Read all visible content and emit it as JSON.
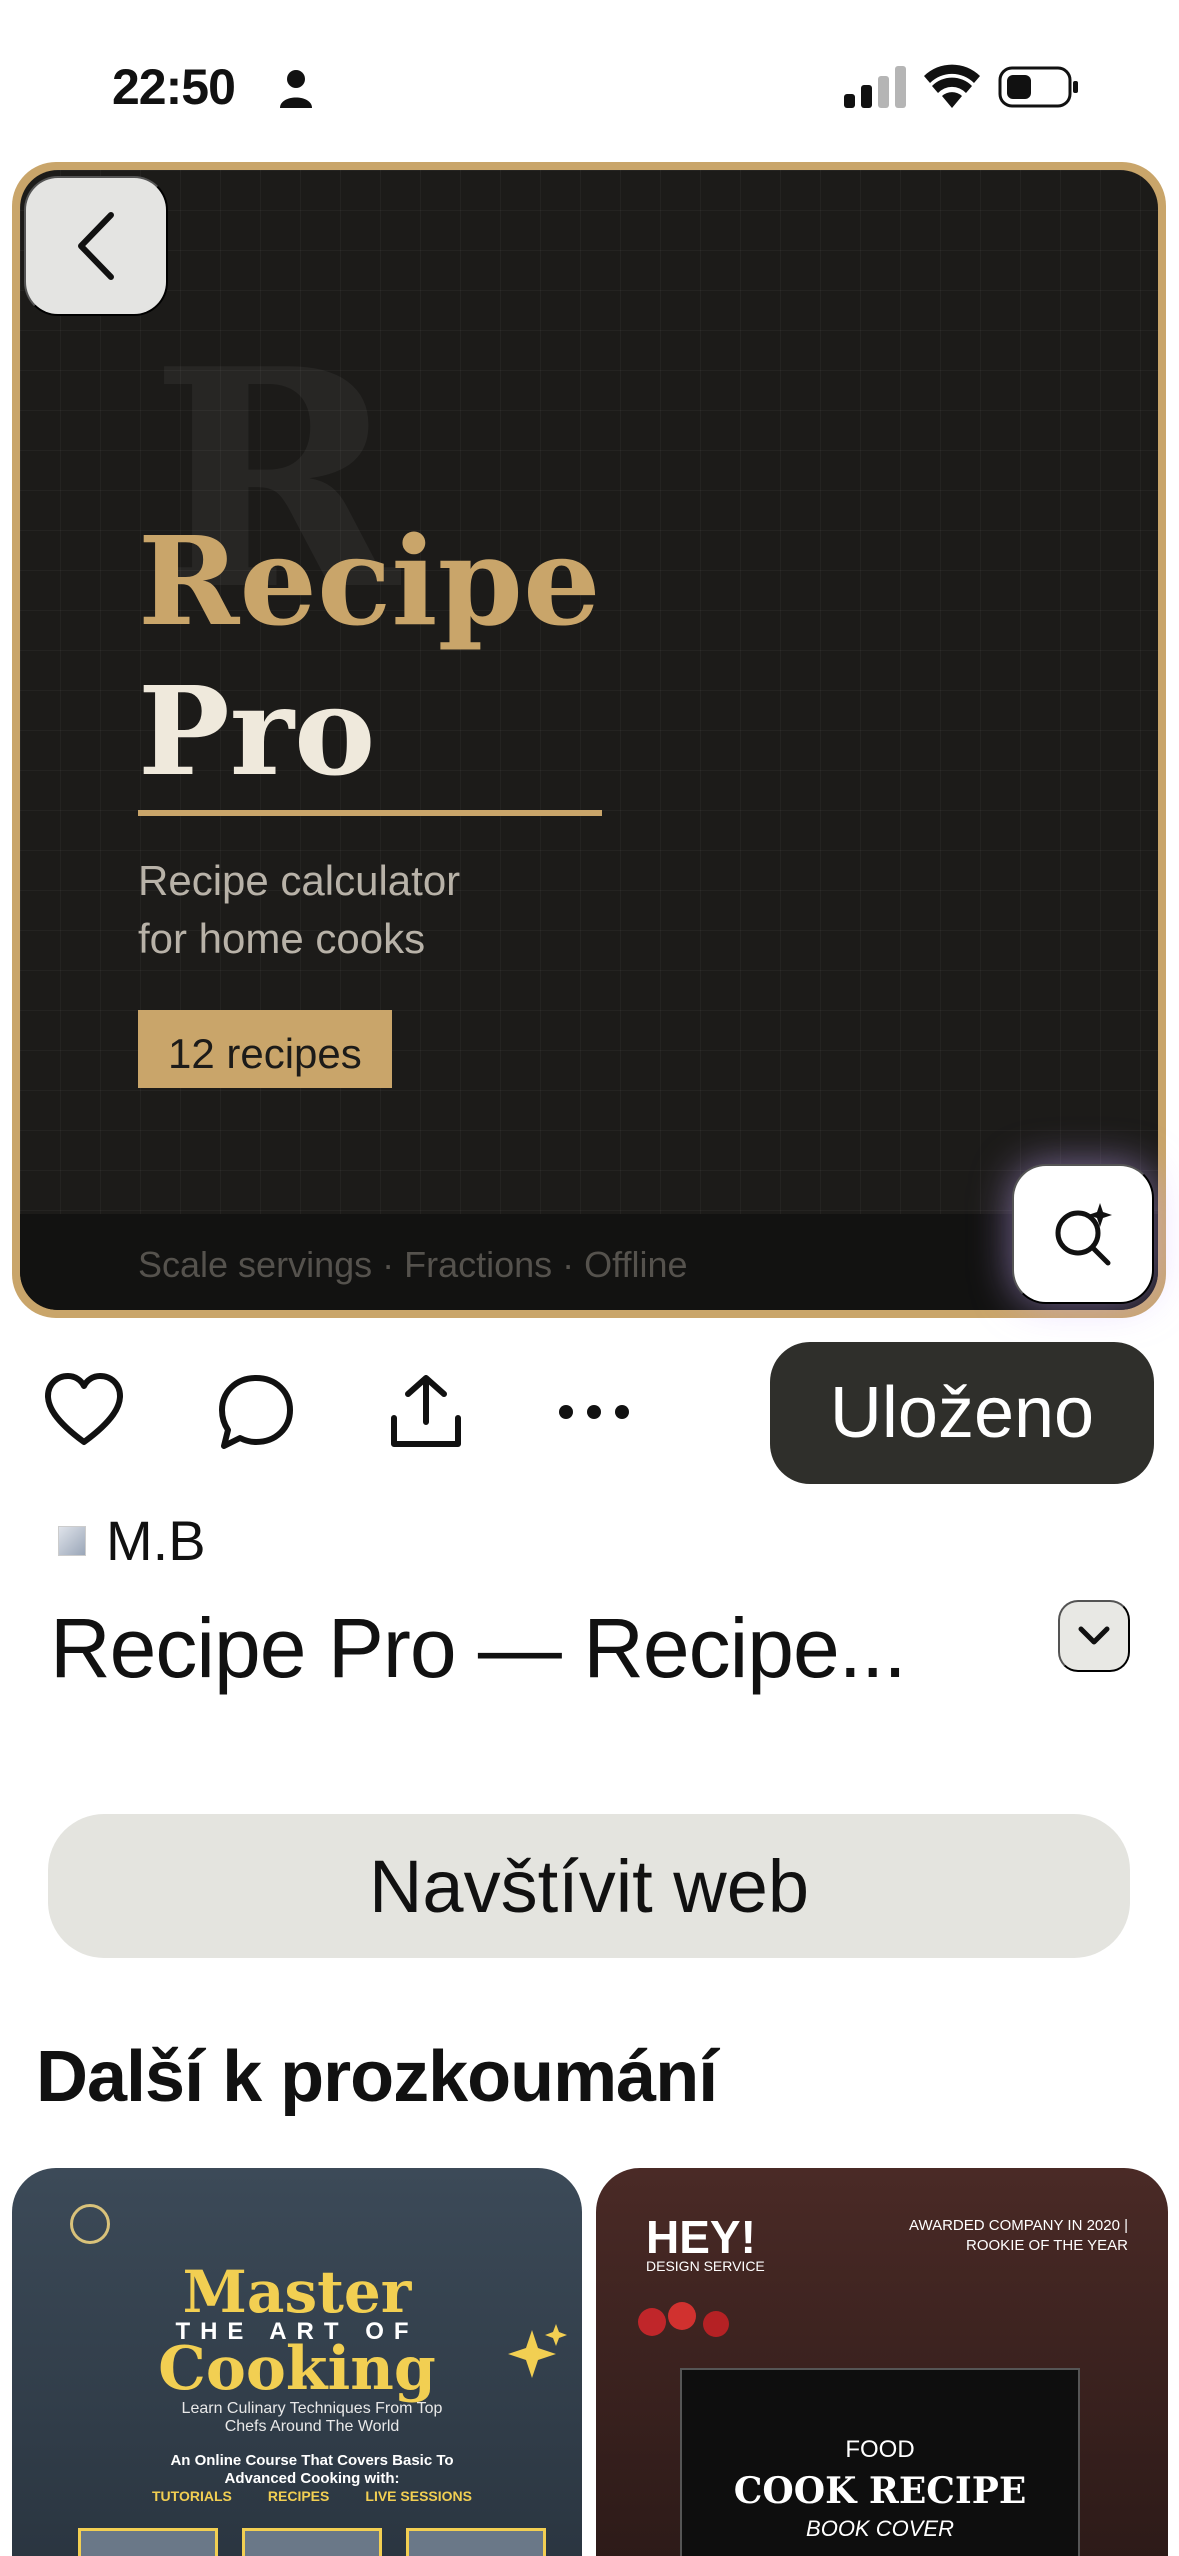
{
  "status_bar": {
    "time": "22:50",
    "icons": [
      "person-icon",
      "signal-icon",
      "wifi-icon",
      "battery-icon"
    ]
  },
  "hero": {
    "background_letter": "R",
    "title_line_1": "Recipe",
    "title_line_2": "Pro",
    "subtitle_line_1": "Recipe calculator",
    "subtitle_line_2": "for home cooks",
    "badge": "12 recipes",
    "features": "Scale servings · Fractions · Offline",
    "colors": {
      "gold": "#c9a56a",
      "dark": "#1c1b19",
      "cream": "#efe9dc"
    }
  },
  "actions": {
    "icons": [
      "heart-icon",
      "comment-icon",
      "share-icon",
      "more-icon"
    ],
    "saved_label": "Uloženo"
  },
  "author": {
    "name": "M.B"
  },
  "pin": {
    "title": "Recipe Pro — Recipe..."
  },
  "visit_label": "Navštívit web",
  "explore": {
    "heading": "Další k prozkoumání",
    "cards": [
      {
        "title_a": "Master",
        "title_b": "THE ART OF",
        "title_c": "Cooking",
        "subtitle": "Learn Culinary Techniques From Top Chefs Around The World",
        "course": "An Online Course That Covers Basic To Advanced Cooking with:",
        "tags": [
          "TUTORIALS",
          "RECIPES",
          "LIVE SESSIONS"
        ]
      },
      {
        "hey": "HEY!",
        "design": "DESIGN SERVICE",
        "award": "AWARDED COMPANY IN 2020 | ROOKIE OF THE YEAR",
        "food": "FOOD",
        "cook": "COOK RECIPE",
        "cover": "BOOK COVER"
      }
    ]
  }
}
